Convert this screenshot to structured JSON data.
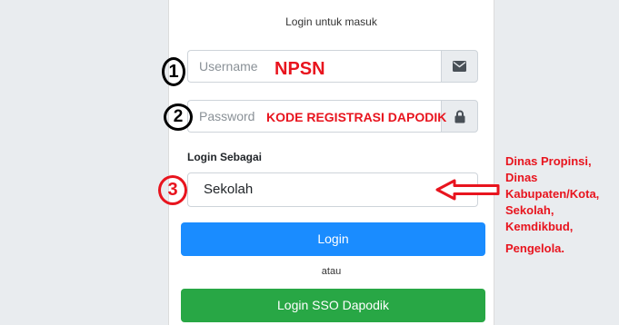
{
  "form": {
    "title": "Login untuk masuk",
    "username_placeholder": "Username",
    "password_placeholder": "Password",
    "login_as_label": "Login Sebagai",
    "login_as_value": "Sekolah",
    "login_button": "Login",
    "or_text": "atau",
    "sso_button": "Login SSO Dapodik"
  },
  "annotations": {
    "step1": "1",
    "step2": "2",
    "step3": "3",
    "username_note": "NPSN",
    "password_note": "KODE REGISTRASI DAPODIK",
    "role_options": [
      "Dinas Propinsi,",
      "Dinas",
      "Kabupaten/Kota,",
      "Sekolah,",
      "Kemdikbud,",
      "Pengelola."
    ]
  },
  "colors": {
    "annotation_red": "#e8141e",
    "login_blue": "#1a8cff",
    "sso_green": "#28a745"
  },
  "icons": {
    "username_addon": "envelope-icon",
    "password_addon": "lock-icon",
    "select_arrow": "chevron-down-icon",
    "arrow": "left-arrow-icon"
  }
}
